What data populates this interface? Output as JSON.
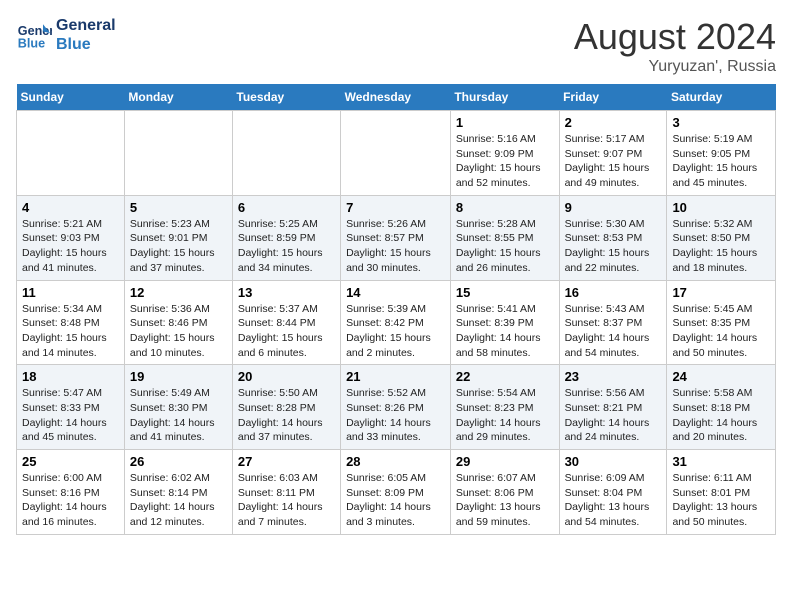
{
  "header": {
    "logo_line1": "General",
    "logo_line2": "Blue",
    "month_year": "August 2024",
    "location": "Yuryuzan', Russia"
  },
  "weekdays": [
    "Sunday",
    "Monday",
    "Tuesday",
    "Wednesday",
    "Thursday",
    "Friday",
    "Saturday"
  ],
  "weeks": [
    [
      {
        "day": "",
        "info": ""
      },
      {
        "day": "",
        "info": ""
      },
      {
        "day": "",
        "info": ""
      },
      {
        "day": "",
        "info": ""
      },
      {
        "day": "1",
        "info": "Sunrise: 5:16 AM\nSunset: 9:09 PM\nDaylight: 15 hours\nand 52 minutes."
      },
      {
        "day": "2",
        "info": "Sunrise: 5:17 AM\nSunset: 9:07 PM\nDaylight: 15 hours\nand 49 minutes."
      },
      {
        "day": "3",
        "info": "Sunrise: 5:19 AM\nSunset: 9:05 PM\nDaylight: 15 hours\nand 45 minutes."
      }
    ],
    [
      {
        "day": "4",
        "info": "Sunrise: 5:21 AM\nSunset: 9:03 PM\nDaylight: 15 hours\nand 41 minutes."
      },
      {
        "day": "5",
        "info": "Sunrise: 5:23 AM\nSunset: 9:01 PM\nDaylight: 15 hours\nand 37 minutes."
      },
      {
        "day": "6",
        "info": "Sunrise: 5:25 AM\nSunset: 8:59 PM\nDaylight: 15 hours\nand 34 minutes."
      },
      {
        "day": "7",
        "info": "Sunrise: 5:26 AM\nSunset: 8:57 PM\nDaylight: 15 hours\nand 30 minutes."
      },
      {
        "day": "8",
        "info": "Sunrise: 5:28 AM\nSunset: 8:55 PM\nDaylight: 15 hours\nand 26 minutes."
      },
      {
        "day": "9",
        "info": "Sunrise: 5:30 AM\nSunset: 8:53 PM\nDaylight: 15 hours\nand 22 minutes."
      },
      {
        "day": "10",
        "info": "Sunrise: 5:32 AM\nSunset: 8:50 PM\nDaylight: 15 hours\nand 18 minutes."
      }
    ],
    [
      {
        "day": "11",
        "info": "Sunrise: 5:34 AM\nSunset: 8:48 PM\nDaylight: 15 hours\nand 14 minutes."
      },
      {
        "day": "12",
        "info": "Sunrise: 5:36 AM\nSunset: 8:46 PM\nDaylight: 15 hours\nand 10 minutes."
      },
      {
        "day": "13",
        "info": "Sunrise: 5:37 AM\nSunset: 8:44 PM\nDaylight: 15 hours\nand 6 minutes."
      },
      {
        "day": "14",
        "info": "Sunrise: 5:39 AM\nSunset: 8:42 PM\nDaylight: 15 hours\nand 2 minutes."
      },
      {
        "day": "15",
        "info": "Sunrise: 5:41 AM\nSunset: 8:39 PM\nDaylight: 14 hours\nand 58 minutes."
      },
      {
        "day": "16",
        "info": "Sunrise: 5:43 AM\nSunset: 8:37 PM\nDaylight: 14 hours\nand 54 minutes."
      },
      {
        "day": "17",
        "info": "Sunrise: 5:45 AM\nSunset: 8:35 PM\nDaylight: 14 hours\nand 50 minutes."
      }
    ],
    [
      {
        "day": "18",
        "info": "Sunrise: 5:47 AM\nSunset: 8:33 PM\nDaylight: 14 hours\nand 45 minutes."
      },
      {
        "day": "19",
        "info": "Sunrise: 5:49 AM\nSunset: 8:30 PM\nDaylight: 14 hours\nand 41 minutes."
      },
      {
        "day": "20",
        "info": "Sunrise: 5:50 AM\nSunset: 8:28 PM\nDaylight: 14 hours\nand 37 minutes."
      },
      {
        "day": "21",
        "info": "Sunrise: 5:52 AM\nSunset: 8:26 PM\nDaylight: 14 hours\nand 33 minutes."
      },
      {
        "day": "22",
        "info": "Sunrise: 5:54 AM\nSunset: 8:23 PM\nDaylight: 14 hours\nand 29 minutes."
      },
      {
        "day": "23",
        "info": "Sunrise: 5:56 AM\nSunset: 8:21 PM\nDaylight: 14 hours\nand 24 minutes."
      },
      {
        "day": "24",
        "info": "Sunrise: 5:58 AM\nSunset: 8:18 PM\nDaylight: 14 hours\nand 20 minutes."
      }
    ],
    [
      {
        "day": "25",
        "info": "Sunrise: 6:00 AM\nSunset: 8:16 PM\nDaylight: 14 hours\nand 16 minutes."
      },
      {
        "day": "26",
        "info": "Sunrise: 6:02 AM\nSunset: 8:14 PM\nDaylight: 14 hours\nand 12 minutes."
      },
      {
        "day": "27",
        "info": "Sunrise: 6:03 AM\nSunset: 8:11 PM\nDaylight: 14 hours\nand 7 minutes."
      },
      {
        "day": "28",
        "info": "Sunrise: 6:05 AM\nSunset: 8:09 PM\nDaylight: 14 hours\nand 3 minutes."
      },
      {
        "day": "29",
        "info": "Sunrise: 6:07 AM\nSunset: 8:06 PM\nDaylight: 13 hours\nand 59 minutes."
      },
      {
        "day": "30",
        "info": "Sunrise: 6:09 AM\nSunset: 8:04 PM\nDaylight: 13 hours\nand 54 minutes."
      },
      {
        "day": "31",
        "info": "Sunrise: 6:11 AM\nSunset: 8:01 PM\nDaylight: 13 hours\nand 50 minutes."
      }
    ]
  ]
}
